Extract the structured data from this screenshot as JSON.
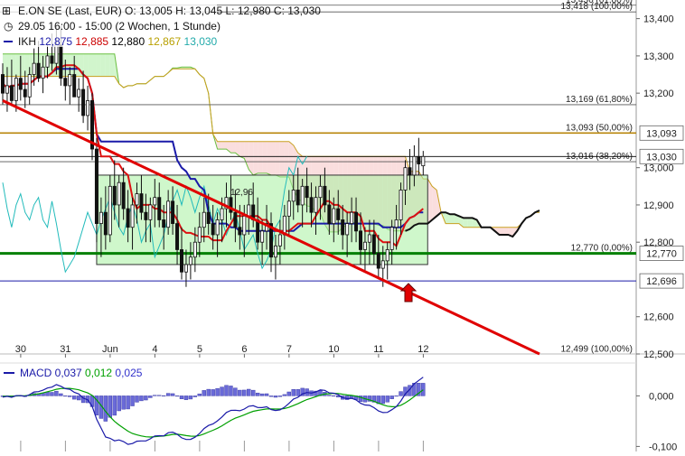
{
  "header": {
    "instrument": "E.ON SE (Last, EUR)",
    "ohlc": {
      "o_label": "O:",
      "o": "13,005",
      "h_label": "H:",
      "h": "13,045",
      "l_label": "L:",
      "l": "12,980",
      "c_label": "C:",
      "c": "13,030"
    },
    "period": "29.05 16:00 - 15:00 (2 Wochen, 1 Stunde)",
    "ikh_label": "IKH",
    "ikh_values": [
      "12,875",
      "12,885",
      "12,880",
      "12,867",
      "13,030"
    ],
    "ikh_colors": [
      "#1a1aa8",
      "#cc0000",
      "#000000",
      "#b8a000",
      "#22aaaa"
    ]
  },
  "macd_header": {
    "label": "MACD",
    "values": [
      "0,037",
      "0,012",
      "0,025"
    ],
    "colors": [
      "#1a1aa8",
      "#00a000",
      "#3333cc"
    ]
  },
  "chart_data": {
    "type": "candlestick",
    "y_axis": {
      "range": [
        12.5,
        13.45
      ],
      "ticks": [
        {
          "v": 13.4,
          "label": "13,400"
        },
        {
          "v": 13.3,
          "label": "13,300"
        },
        {
          "v": 13.2,
          "label": "13,200"
        },
        {
          "v": 13.0,
          "label": "13,000"
        },
        {
          "v": 12.9,
          "label": "12,900"
        },
        {
          "v": 12.8,
          "label": "12,800"
        },
        {
          "v": 12.6,
          "label": "12,600"
        },
        {
          "v": 12.5,
          "label": "12,500"
        }
      ]
    },
    "x_axis": {
      "ticks": [
        {
          "label": "30",
          "i": 2
        },
        {
          "label": "31",
          "i": 12
        },
        {
          "label": "Jun",
          "i": 22
        },
        {
          "label": "4",
          "i": 32
        },
        {
          "label": "5",
          "i": 42
        },
        {
          "label": "6",
          "i": 52
        },
        {
          "label": "7",
          "i": 62
        },
        {
          "label": "10",
          "i": 72
        },
        {
          "label": "11",
          "i": 82
        },
        {
          "label": "12",
          "i": 92
        }
      ]
    },
    "price_levels": [
      {
        "value": 13.093,
        "label": "13,093",
        "color": "#b8860b"
      },
      {
        "value": 13.03,
        "label": "13,030",
        "color": "#000000"
      },
      {
        "value": 12.77,
        "label": "12,770",
        "color": "#008000"
      },
      {
        "value": 12.696,
        "label": "12,696",
        "color": "#1a1aa8"
      }
    ],
    "fib_levels": [
      {
        "value": 13.436,
        "label": "13,436 (61,80%)"
      },
      {
        "value": 13.418,
        "label": "13,418 (100,00%)"
      },
      {
        "value": 13.169,
        "label": "13,169 (61,80%)"
      },
      {
        "value": 13.093,
        "label": "13,093 (50,00%)"
      },
      {
        "value": 13.016,
        "label": "13,016 (38,20%)"
      },
      {
        "value": 12.77,
        "label": "12,770 (0,00%)"
      },
      {
        "value": 12.499,
        "label": "12,499 (100,00%)"
      }
    ],
    "box": {
      "i_start": 21,
      "i_end": 95,
      "top": 12.98,
      "bottom": 12.74,
      "label": "12,96"
    },
    "trendline": [
      [
        0,
        13.18
      ],
      [
        120,
        12.5
      ]
    ],
    "candles": [
      [
        13.25,
        13.28,
        13.17,
        13.2
      ],
      [
        13.2,
        13.27,
        13.15,
        13.22
      ],
      [
        13.22,
        13.29,
        13.17,
        13.18
      ],
      [
        13.18,
        13.25,
        13.15,
        13.24
      ],
      [
        13.24,
        13.3,
        13.18,
        13.21
      ],
      [
        13.21,
        13.26,
        13.16,
        13.19
      ],
      [
        13.19,
        13.27,
        13.17,
        13.25
      ],
      [
        13.25,
        13.32,
        13.22,
        13.28
      ],
      [
        13.28,
        13.34,
        13.23,
        13.24
      ],
      [
        13.24,
        13.3,
        13.2,
        13.27
      ],
      [
        13.27,
        13.33,
        13.24,
        13.3
      ],
      [
        13.3,
        13.36,
        13.26,
        13.28
      ],
      [
        13.28,
        13.38,
        13.25,
        13.33
      ],
      [
        13.33,
        13.38,
        13.22,
        13.24
      ],
      [
        13.24,
        13.29,
        13.18,
        13.22
      ],
      [
        13.22,
        13.27,
        13.17,
        13.25
      ],
      [
        13.25,
        13.3,
        13.2,
        13.19
      ],
      [
        13.19,
        13.24,
        13.15,
        13.21
      ],
      [
        13.21,
        13.26,
        13.12,
        13.14
      ],
      [
        13.14,
        13.22,
        13.1,
        13.18
      ],
      [
        13.18,
        13.2,
        13.02,
        13.05
      ],
      [
        13.05,
        13.08,
        12.8,
        12.85
      ],
      [
        12.85,
        12.92,
        12.76,
        12.88
      ],
      [
        12.88,
        12.95,
        12.78,
        12.82
      ],
      [
        12.82,
        12.98,
        12.8,
        12.95
      ],
      [
        12.95,
        13.02,
        12.86,
        12.9
      ],
      [
        12.9,
        12.98,
        12.84,
        12.96
      ],
      [
        12.96,
        13.0,
        12.86,
        12.89
      ],
      [
        12.89,
        12.94,
        12.8,
        12.84
      ],
      [
        12.84,
        12.92,
        12.78,
        12.9
      ],
      [
        12.9,
        12.96,
        12.85,
        12.93
      ],
      [
        12.93,
        12.98,
        12.86,
        12.88
      ],
      [
        12.88,
        12.93,
        12.8,
        12.86
      ],
      [
        12.86,
        12.92,
        12.8,
        12.9
      ],
      [
        12.9,
        12.97,
        12.84,
        12.92
      ],
      [
        12.92,
        12.96,
        12.84,
        12.86
      ],
      [
        12.86,
        12.9,
        12.78,
        12.84
      ],
      [
        12.84,
        12.94,
        12.82,
        12.91
      ],
      [
        12.91,
        12.95,
        12.82,
        12.85
      ],
      [
        12.85,
        12.9,
        12.74,
        12.78
      ],
      [
        12.78,
        12.84,
        12.7,
        12.72
      ],
      [
        12.72,
        12.78,
        12.68,
        12.74
      ],
      [
        12.74,
        12.8,
        12.7,
        12.76
      ],
      [
        12.76,
        12.84,
        12.72,
        12.8
      ],
      [
        12.8,
        12.88,
        12.76,
        12.84
      ],
      [
        12.84,
        12.92,
        12.8,
        12.88
      ],
      [
        12.88,
        12.93,
        12.82,
        12.85
      ],
      [
        12.85,
        12.9,
        12.78,
        12.82
      ],
      [
        12.82,
        12.88,
        12.76,
        12.86
      ],
      [
        12.86,
        12.92,
        12.8,
        12.89
      ],
      [
        12.89,
        12.96,
        12.84,
        12.92
      ],
      [
        12.92,
        12.98,
        12.86,
        12.88
      ],
      [
        12.88,
        12.94,
        12.8,
        12.84
      ],
      [
        12.84,
        12.9,
        12.78,
        12.82
      ],
      [
        12.82,
        12.9,
        12.76,
        12.87
      ],
      [
        12.87,
        12.94,
        12.82,
        12.9
      ],
      [
        12.9,
        12.96,
        12.84,
        12.86
      ],
      [
        12.86,
        12.92,
        12.78,
        12.8
      ],
      [
        12.8,
        12.86,
        12.74,
        12.83
      ],
      [
        12.83,
        12.9,
        12.78,
        12.85
      ],
      [
        12.85,
        12.88,
        12.72,
        12.76
      ],
      [
        12.76,
        12.82,
        12.7,
        12.79
      ],
      [
        12.79,
        12.86,
        12.74,
        12.82
      ],
      [
        12.82,
        12.9,
        12.78,
        12.87
      ],
      [
        12.87,
        12.94,
        12.82,
        12.91
      ],
      [
        12.91,
        12.98,
        12.86,
        12.94
      ],
      [
        12.94,
        13.0,
        12.88,
        12.9
      ],
      [
        12.9,
        12.97,
        12.84,
        12.95
      ],
      [
        12.95,
        13.0,
        12.88,
        12.92
      ],
      [
        12.92,
        12.96,
        12.84,
        12.88
      ],
      [
        12.88,
        12.95,
        12.82,
        12.92
      ],
      [
        12.92,
        12.98,
        12.86,
        12.95
      ],
      [
        12.95,
        13.0,
        12.88,
        12.9
      ],
      [
        12.9,
        12.94,
        12.82,
        12.85
      ],
      [
        12.85,
        12.92,
        12.8,
        12.89
      ],
      [
        12.89,
        12.94,
        12.82,
        12.86
      ],
      [
        12.86,
        12.9,
        12.78,
        12.82
      ],
      [
        12.82,
        12.88,
        12.76,
        12.85
      ],
      [
        12.85,
        12.92,
        12.8,
        12.88
      ],
      [
        12.88,
        12.92,
        12.8,
        12.83
      ],
      [
        12.83,
        12.88,
        12.74,
        12.78
      ],
      [
        12.78,
        12.84,
        12.72,
        12.8
      ],
      [
        12.8,
        12.86,
        12.74,
        12.82
      ],
      [
        12.82,
        12.86,
        12.74,
        12.77
      ],
      [
        12.77,
        12.82,
        12.7,
        12.73
      ],
      [
        12.73,
        12.79,
        12.68,
        12.75
      ],
      [
        12.75,
        12.8,
        12.7,
        12.78
      ],
      [
        12.78,
        12.86,
        12.74,
        12.84
      ],
      [
        12.84,
        12.9,
        12.78,
        12.86
      ],
      [
        12.86,
        12.96,
        12.82,
        12.94
      ],
      [
        12.94,
        13.02,
        12.9,
        13.0
      ],
      [
        13.0,
        13.05,
        12.94,
        12.98
      ],
      [
        12.98,
        13.06,
        12.95,
        13.03
      ],
      [
        13.03,
        13.08,
        12.98,
        13.01
      ],
      [
        13.005,
        13.045,
        12.98,
        13.03
      ]
    ],
    "macd_axis": {
      "range": [
        -0.11,
        0.065
      ],
      "ticks": [
        {
          "v": 0.0,
          "label": "0,000"
        },
        {
          "v": -0.1,
          "label": "-0,100"
        }
      ]
    },
    "macd_last": [
      0.037,
      0.012,
      0.025
    ]
  }
}
